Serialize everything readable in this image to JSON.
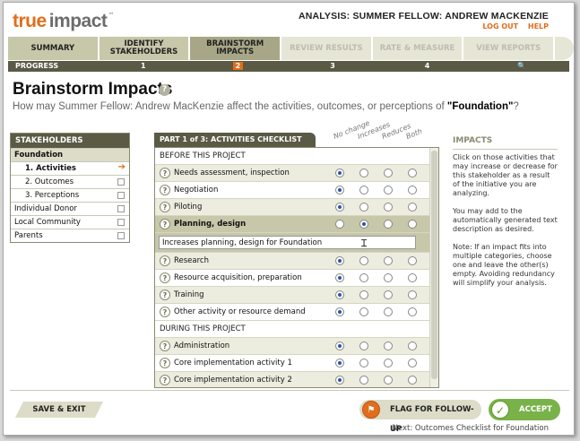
{
  "header": {
    "logo_primary": "true",
    "logo_secondary": "impact",
    "logo_tm": "™",
    "analysis_title": "ANALYSIS: SUMMER FELLOW: ANDREW MACKENZIE",
    "logout": "LOG OUT",
    "help": "HELP"
  },
  "steps": [
    {
      "label": "SUMMARY",
      "state": "done"
    },
    {
      "label": "IDENTIFY STAKEHOLDERS",
      "state": "done"
    },
    {
      "label": "BRAINSTORM IMPACTS",
      "state": "active"
    },
    {
      "label": "REVIEW RESULTS",
      "state": "future"
    },
    {
      "label": "RATE & MEASURE",
      "state": "future"
    },
    {
      "label": "VIEW REPORTS",
      "state": "future"
    }
  ],
  "progress": {
    "label": "PROGRESS",
    "numbers": [
      "1",
      "2",
      "3",
      "4",
      "🔍"
    ]
  },
  "page": {
    "title": "Brainstorm Impacts",
    "help_icon": "?",
    "question_prefix": "How may Summer Fellow: Andrew MacKenzie affect the activities, outcomes, or perceptions of ",
    "question_target": "\"Foundation\"",
    "question_suffix": "?"
  },
  "stakeholders": {
    "header": "STAKEHOLDERS",
    "rows": [
      {
        "label": "Foundation",
        "type": "group"
      },
      {
        "label": "1. Activities",
        "type": "sub-current"
      },
      {
        "label": "2. Outcomes",
        "type": "sub"
      },
      {
        "label": "3. Perceptions",
        "type": "sub"
      },
      {
        "label": "Individual Donor",
        "type": "other"
      },
      {
        "label": "Local Community",
        "type": "other"
      },
      {
        "label": "Parents",
        "type": "other"
      }
    ]
  },
  "checklist": {
    "tab": "PART 1 of 3: ACTIVITIES CHECKLIST",
    "columns": [
      "No change",
      "Increases",
      "Reduces",
      "Both"
    ],
    "sections": [
      {
        "title": "BEFORE THIS PROJECT",
        "items": [
          {
            "label": "Needs assessment, inspection",
            "selected": 0
          },
          {
            "label": "Negotiation",
            "selected": 0
          },
          {
            "label": "Piloting",
            "selected": 0
          },
          {
            "label": "Planning, design",
            "selected": 1,
            "expanded": true,
            "text": "Increases planning, design for Foundation"
          },
          {
            "label": "Research",
            "selected": 0
          },
          {
            "label": "Resource acquisition, preparation",
            "selected": 0
          },
          {
            "label": "Training",
            "selected": 0
          },
          {
            "label": "Other activity or resource demand",
            "selected": 0
          }
        ]
      },
      {
        "title": "DURING THIS PROJECT",
        "items": [
          {
            "label": "Administration",
            "selected": 0
          },
          {
            "label": "Core implementation activity 1",
            "selected": 0
          },
          {
            "label": "Core implementation activity 2",
            "selected": 0
          }
        ]
      }
    ]
  },
  "impacts": {
    "header": "IMPACTS",
    "paragraphs": [
      "Click on those activities that may increase or decrease for this stakeholder as a result of the initiative you are analyzing.",
      "You may add to the automatically generated text description as desired.",
      "Note: If an impact fits into multiple categories, choose one and leave the other(s) empty. Avoiding redundancy will simplify your analysis."
    ]
  },
  "footer": {
    "save": "SAVE & EXIT",
    "flag": "FLAG FOR FOLLOW-UP",
    "accept": "ACCEPT",
    "next": "Next: Outcomes Checklist for Foundation"
  }
}
